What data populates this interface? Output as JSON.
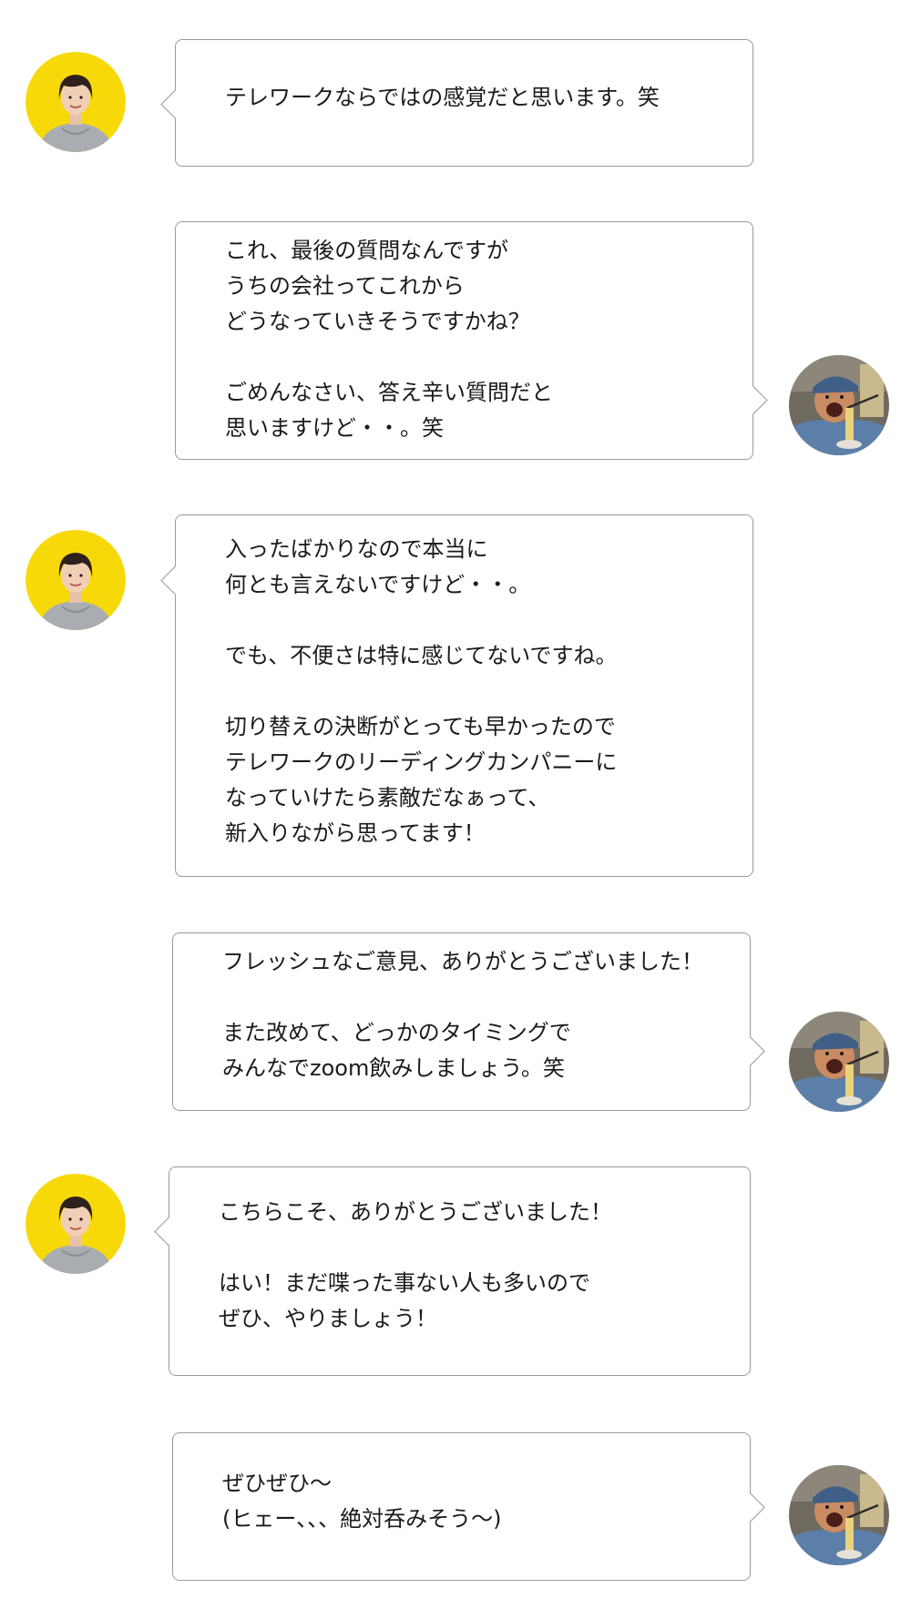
{
  "conversation": {
    "messages": [
      {
        "speaker": "woman",
        "text": "テレワークならではの感覚だと思います。笑"
      },
      {
        "speaker": "man",
        "text": "これ、最後の質問なんですが\nうちの会社ってこれから\nどうなっていきそうですかね？\n\nごめんなさい、答え辛い質問だと\n思いますけど・・。笑"
      },
      {
        "speaker": "woman",
        "text": "入ったばかりなので本当に\n何とも言えないですけど・・。\n\nでも、不便さは特に感じてないですね。\n\n切り替えの決断がとっても早かったので\nテレワークのリーディングカンパニーに\nなっていけたら素敵だなぁって、\n新入りながら思ってます！"
      },
      {
        "speaker": "man",
        "text": "フレッシュなご意見、ありがとうございました！\n\nまた改めて、どっかのタイミングで\nみんなでzoom飲みしましょう。笑"
      },
      {
        "speaker": "woman",
        "text": "こちらこそ、ありがとうございました！\n\nはい！まだ喋った事ない人も多いので\nぜひ、やりましょう！"
      },
      {
        "speaker": "man",
        "text": "ぜひぜひ〜\n(ヒェー、、、絶対呑みそう〜)"
      }
    ]
  },
  "colors": {
    "woman_avatar_bg": "#f7d90a",
    "bubble_border": "#9a9a9a"
  }
}
